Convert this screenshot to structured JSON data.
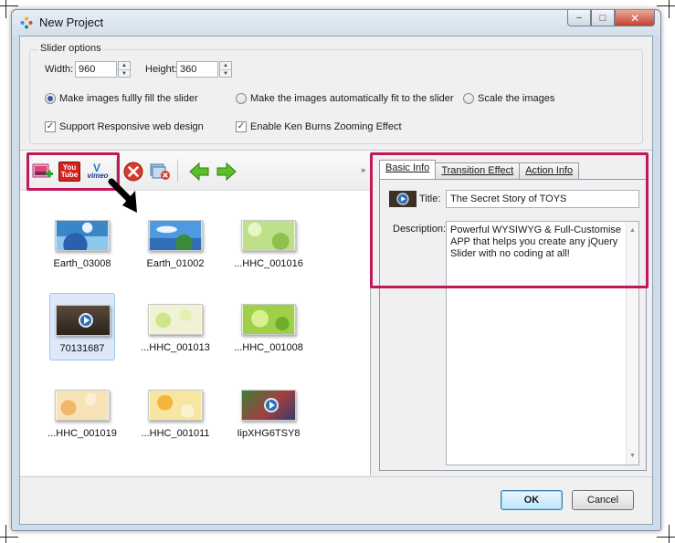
{
  "window": {
    "title": "New Project",
    "controls": {
      "minimize": "−",
      "maximize": "□",
      "close": "✕"
    }
  },
  "slider_options": {
    "legend": "Slider options",
    "width_label": "Width:",
    "width_value": "960",
    "height_label": "Height:",
    "height_value": "360",
    "radios": [
      {
        "label": "Make images fullly fill the slider",
        "checked": true
      },
      {
        "label": "Make the images automatically fit to the slider",
        "checked": false
      },
      {
        "label": "Scale the images",
        "checked": false
      }
    ],
    "checkboxes": [
      {
        "label": "Support Responsive web design",
        "checked": true
      },
      {
        "label": "Enable Ken Burns Zooming Effect",
        "checked": true
      }
    ]
  },
  "toolbar": {
    "add_image_icon": "add-image-icon",
    "youtube_label": "You Tube",
    "vimeo_label": "vimeo",
    "overflow": "»"
  },
  "thumbnails": [
    {
      "label": "Earth_03008",
      "selected": false,
      "video": false
    },
    {
      "label": "Earth_01002",
      "selected": false,
      "video": false
    },
    {
      "label": "...HHC_001016",
      "selected": false,
      "video": false
    },
    {
      "label": "70131687",
      "selected": true,
      "video": true
    },
    {
      "label": "...HHC_001013",
      "selected": false,
      "video": false
    },
    {
      "label": "...HHC_001008",
      "selected": false,
      "video": false
    },
    {
      "label": "...HHC_001019",
      "selected": false,
      "video": false
    },
    {
      "label": "...HHC_001011",
      "selected": false,
      "video": false
    },
    {
      "label": "IipXHG6TSY8",
      "selected": false,
      "video": true
    }
  ],
  "info_panel": {
    "tabs": [
      "Basic Info",
      "Transition Effect",
      "Action Info"
    ],
    "active_tab": "Basic Info",
    "title_label": "Title:",
    "title_value": "The Secret Story of TOYS",
    "description_label": "Description:",
    "description_value": "Powerful WYSIWYG & Full-Customise APP that helps you create any jQuery Slider with no coding at all!"
  },
  "footer": {
    "ok_label": "OK",
    "cancel_label": "Cancel"
  },
  "colors": {
    "highlight": "#c2185b",
    "selection": "#dbe9f9",
    "nav_arrow": "#4caf26"
  }
}
